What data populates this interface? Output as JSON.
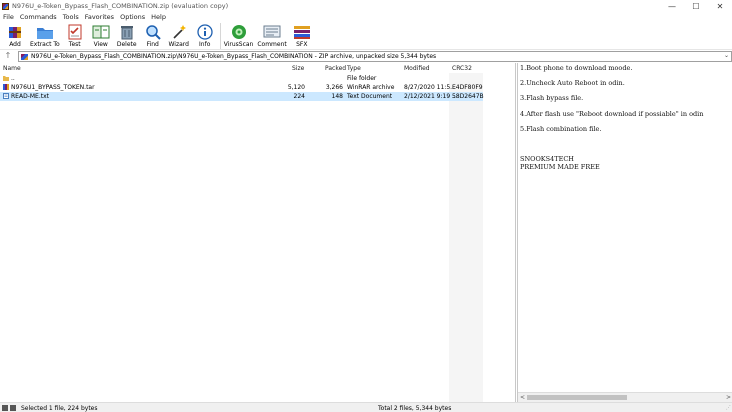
{
  "window": {
    "title": "N976U_e-Token_Bypass_Flash_COMBINATION.zip (evaluation copy)",
    "minimize": "—",
    "maximize": "☐",
    "close": "✕"
  },
  "menu": [
    "File",
    "Commands",
    "Tools",
    "Favorites",
    "Options",
    "Help"
  ],
  "toolbar": [
    {
      "label": "Add",
      "icon": "add-archive-icon"
    },
    {
      "label": "Extract To",
      "icon": "extract-folder-icon"
    },
    {
      "label": "Test",
      "icon": "test-checklist-icon"
    },
    {
      "label": "View",
      "icon": "view-book-icon"
    },
    {
      "label": "Delete",
      "icon": "trash-icon"
    },
    {
      "label": "Find",
      "icon": "magnifier-icon"
    },
    {
      "label": "Wizard",
      "icon": "magic-wand-icon"
    },
    {
      "label": "Info",
      "icon": "info-icon"
    },
    {
      "label": "VirusScan",
      "icon": "virus-scan-icon"
    },
    {
      "label": "Comment",
      "icon": "comment-icon"
    },
    {
      "label": "SFX",
      "icon": "sfx-books-icon"
    }
  ],
  "path": {
    "up": "🡑",
    "text": "N976U_e-Token_Bypass_Flash_COMBINATION.zip\\N976U_e-Token_Bypass_Flash_COMBINATION - ZIP archive, unpacked size 5,344 bytes",
    "dropdown": "⌄"
  },
  "columns": {
    "name": "Name",
    "size": "Size",
    "packed": "Packed",
    "type": "Type",
    "modified": "Modified",
    "crc": "CRC32"
  },
  "files": [
    {
      "name": "..",
      "size": "",
      "packed": "",
      "type": "File folder",
      "modified": "",
      "crc": "",
      "icon": "folder-icon",
      "selected": false
    },
    {
      "name": "N976U1_BYPASS_TOKEN.tar",
      "size": "5,120",
      "packed": "3,266",
      "type": "WinRAR archive",
      "modified": "8/27/2020 11:5...",
      "crc": "E4DF80F9",
      "icon": "rar-archive-icon",
      "selected": false
    },
    {
      "name": "READ-ME.txt",
      "size": "224",
      "packed": "148",
      "type": "Text Document",
      "modified": "2/12/2021 9:19 ...",
      "crc": "58D2647B",
      "icon": "text-file-icon",
      "selected": true
    }
  ],
  "preview": {
    "text": "1.Boot phone to download moode.\n\n2.Uncheck Auto Reboot in odin.\n\n3.Flash bypass file.\n\n4.After flash use \"Reboot download if possiable\" in odin\n\n5.Flash combination file.\n\n\n\nSNOOKS4TECH\nPREMIUM MADE FREE",
    "scroll_left": "<",
    "scroll_right": ">"
  },
  "status": {
    "left": "Selected 1 file, 224 bytes",
    "right": "Total 2 files, 5,344 bytes"
  },
  "colors": {
    "selection": "#cce8ff",
    "accent": "#2a5bd7"
  }
}
